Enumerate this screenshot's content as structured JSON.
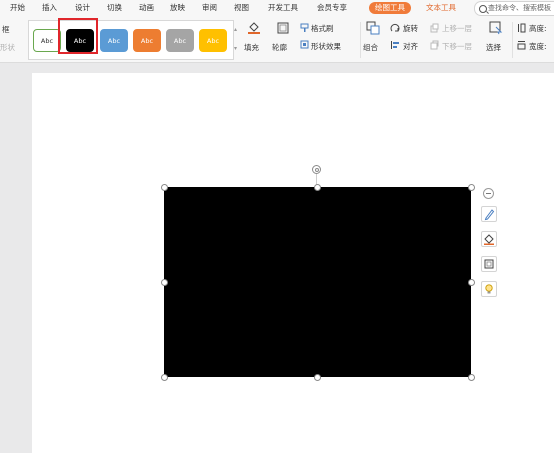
{
  "menubar": {
    "items": [
      "开始",
      "插入",
      "设计",
      "切换",
      "动画",
      "放映",
      "审阅",
      "视图",
      "开发工具",
      "会员专享"
    ],
    "drawing_tools_tab": "绘图工具",
    "text_tools_tab": "文本工具",
    "search_text": "查找命令、搜索模板"
  },
  "ribbon": {
    "left_label_top": "框",
    "left_label_bottom": "形状",
    "styles": [
      {
        "label": "Abc",
        "bg": "#ffffff",
        "fg": "#333333",
        "border": "#6aa84f"
      },
      {
        "label": "Abc",
        "bg": "#000000",
        "fg": "#ffffff",
        "border": "#000000"
      },
      {
        "label": "Abc",
        "bg": "#5b9bd5",
        "fg": "#ffffff",
        "border": "#5b9bd5"
      },
      {
        "label": "Abc",
        "bg": "#ed7d31",
        "fg": "#ffffff",
        "border": "#ed7d31"
      },
      {
        "label": "Abc",
        "bg": "#a5a5a5",
        "fg": "#ffffff",
        "border": "#a5a5a5"
      },
      {
        "label": "Abc",
        "bg": "#ffc000",
        "fg": "#ffffff",
        "border": "#ffc000"
      }
    ],
    "fill_label": "填充",
    "outline_label": "轮廓",
    "format_painter_label": "格式刷",
    "shape_effects_label": "形状效果",
    "rotate_label": "旋转",
    "group_label": "组合",
    "align_label": "对齐",
    "bring_forward_label": "上移一层",
    "send_backward_label": "下移一层",
    "select_label": "选择",
    "height_label": "高度:",
    "width_label": "宽度:"
  },
  "colors": {
    "accent": "#f07b3a",
    "selection_highlight": "#e0262b",
    "shape_fill": "#000000"
  },
  "float_toolbar": [
    "pen-icon",
    "fill-bucket-icon",
    "frame-icon",
    "lightbulb-icon"
  ]
}
